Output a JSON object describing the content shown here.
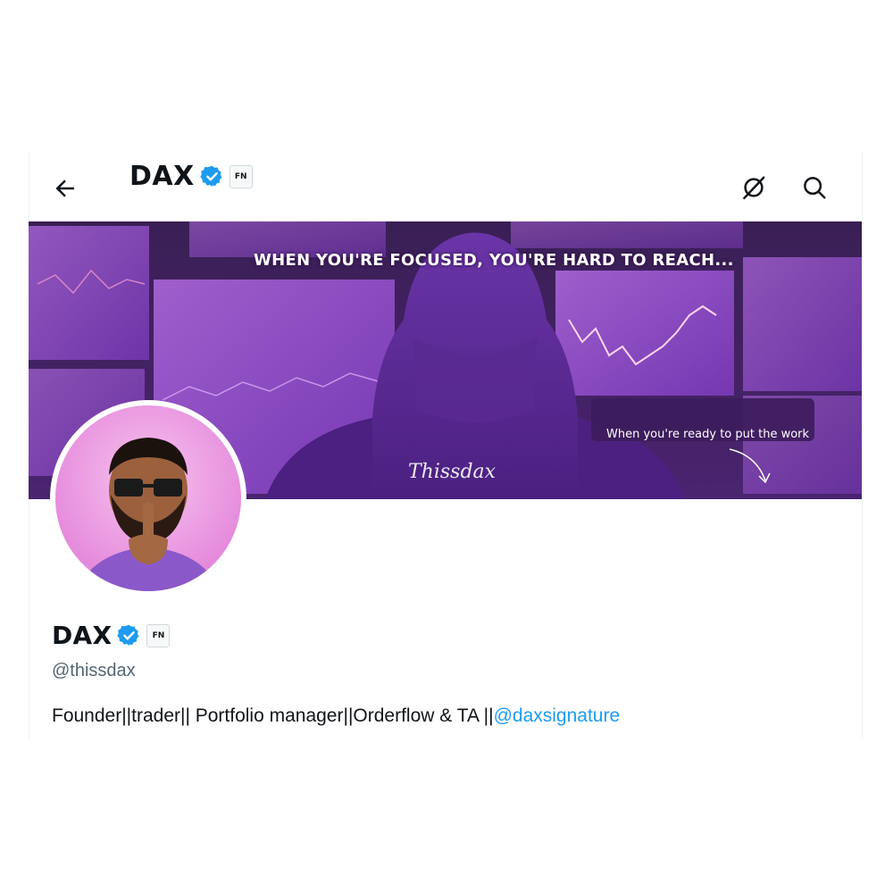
{
  "header": {
    "back_icon": "arrow-left-icon",
    "name": "DAX",
    "verified_icon": "verified-badge-icon",
    "affiliate_badge": "FN",
    "grok_icon": "grok-icon",
    "search_icon": "search-icon"
  },
  "banner": {
    "headline": "WHEN YOU'RE FOCUSED, YOU'RE HARD TO REACH...",
    "tagline": "When you're ready to put the work",
    "signature": "Thissdax"
  },
  "profile": {
    "name": "DAX",
    "affiliate_badge": "FN",
    "handle": "@thissdax",
    "bio_text": "Founder||trader|| Portfolio manager||Orderflow & TA ||",
    "bio_link": "@daxsignature"
  },
  "colors": {
    "accent": "#1d9bf0",
    "banner_purple": "#7b3fb3",
    "avatar_pink": "#e58bdc"
  }
}
